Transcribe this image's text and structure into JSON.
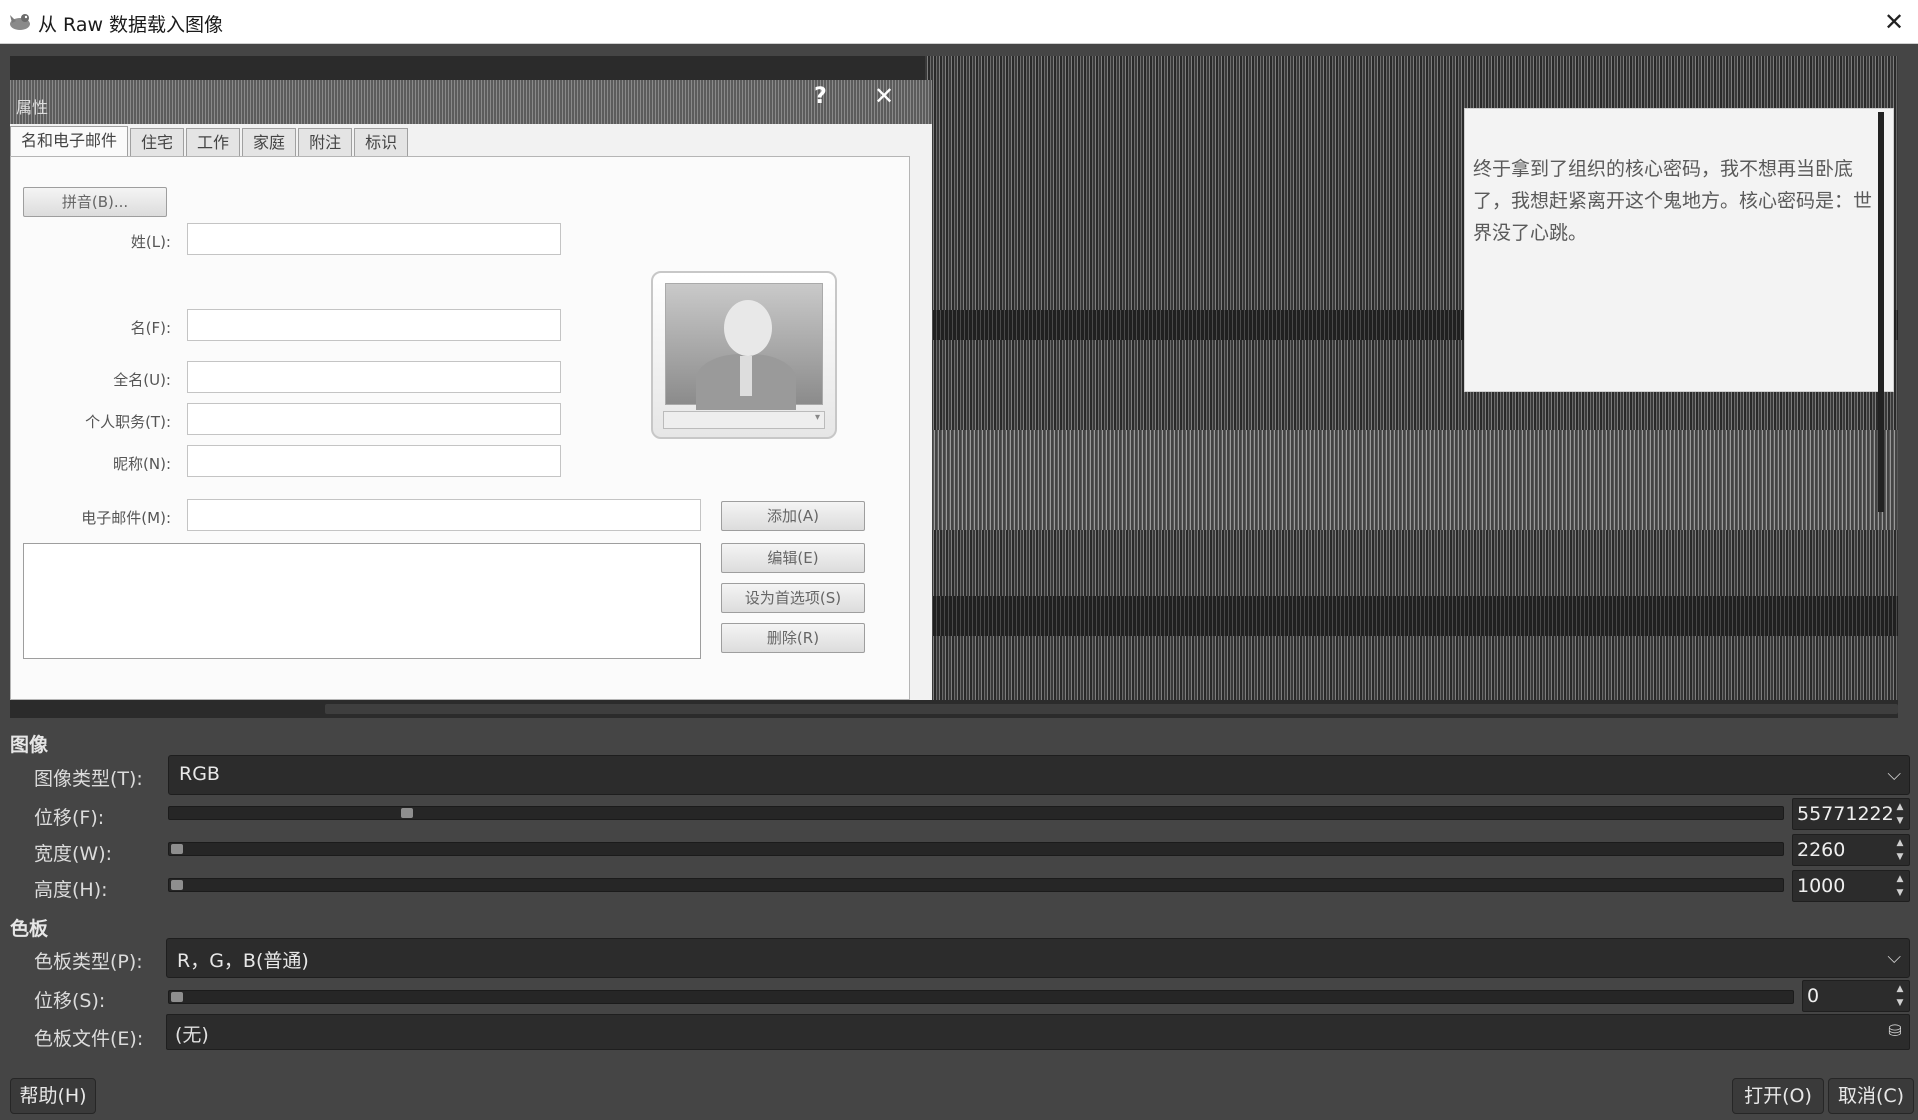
{
  "window": {
    "title": "从 Raw 数据载入图像",
    "close_icon": "close-icon",
    "app_icon": "gimp-wilber-icon"
  },
  "preview": {
    "ghost_dialog": {
      "title_fragment": "属性",
      "help_glyph": "?",
      "close_glyph": "✕",
      "tabs": [
        "名和电子邮件",
        "住宅",
        "工作",
        "家庭",
        "附注",
        "标识"
      ],
      "spell_button": "拼音(B)...",
      "labels": {
        "surname": "姓(L):",
        "given": "名(F):",
        "fullname": "全名(U):",
        "title": "个人职务(T):",
        "nickname": "昵称(N):",
        "email": "电子邮件(M):"
      },
      "buttons": {
        "add": "添加(A)",
        "edit": "编辑(E)",
        "default": "设为首选项(S)",
        "remove": "删除(R)"
      }
    },
    "note_text": "终于拿到了组织的核心密码，我不想再当卧底了，我想赶紧离开这个鬼地方。核心密码是：世界没了心跳。"
  },
  "image_section": {
    "heading": "图像",
    "type_label": "图像类型(T):",
    "type_value": "RGB",
    "offset_label": "位移(F):",
    "offset_value": "55771222",
    "offset_fraction": 0.144,
    "width_label": "宽度(W):",
    "width_value": "2260",
    "width_fraction": 0.0,
    "height_label": "高度(H):",
    "height_value": "1000",
    "height_fraction": 0.0
  },
  "palette_section": {
    "heading": "色板",
    "type_label": "色板类型(P):",
    "type_value": "R，G，B(普通)",
    "offset_label": "位移(S):",
    "offset_value": "0",
    "offset_fraction": 0.0,
    "file_label": "色板文件(E):",
    "file_value": "(无)",
    "file_icon": "open-file-icon"
  },
  "footer": {
    "help": "帮助(H)",
    "open": "打开(O)",
    "cancel": "取消(C)"
  }
}
